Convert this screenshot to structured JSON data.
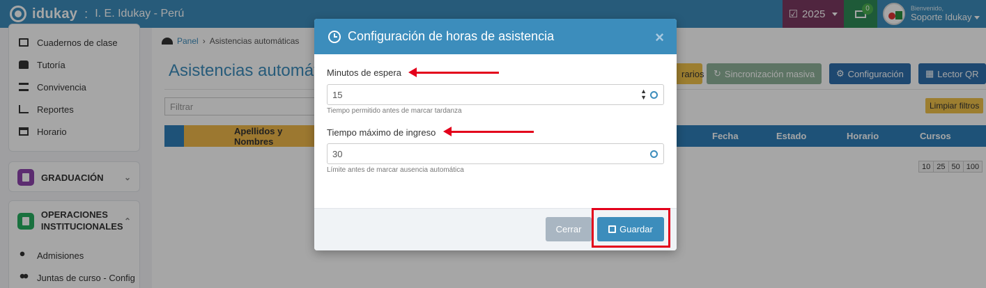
{
  "topbar": {
    "brand": "idukay",
    "separator": ":",
    "institution": "I. E. Idukay - Perú",
    "year": "2025",
    "messages_count": "0",
    "user_greeting": "Bienvenido,",
    "user_name": "Soporte Idukay"
  },
  "sidebar": {
    "top_items": [
      {
        "label": "Cuadernos de clase",
        "icon": "notebook-icon"
      },
      {
        "label": "Tutoría",
        "icon": "thumbs-up-icon"
      },
      {
        "label": "Convivencia",
        "icon": "list-icon"
      },
      {
        "label": "Reportes",
        "icon": "bar-chart-icon"
      },
      {
        "label": "Horario",
        "icon": "calendar-icon"
      }
    ],
    "sections": [
      {
        "label": "GRADUACIÓN",
        "color": "#8e44ad"
      },
      {
        "label": "OPERACIONES INSTITUCIONALES",
        "color": "#27ae60"
      }
    ],
    "bottom_items": [
      {
        "label": "Admisiones",
        "icon": "add-user-icon"
      },
      {
        "label": "Juntas de curso - Config",
        "icon": "users-icon"
      }
    ]
  },
  "breadcrumb": {
    "home": "Panel",
    "current": "Asistencias automáticas"
  },
  "page_title": "Asistencias automáticas",
  "toolbar": {
    "partial_label": "rarios",
    "sync_label": "Sincronización masiva",
    "config_label": "Configuración",
    "qr_label": "Lector QR"
  },
  "filter": {
    "placeholder": "Filtrar"
  },
  "clear_filters": "Limpiar filtros",
  "table": {
    "columns": [
      "Apellidos y Nombres",
      "Fecha",
      "Estado",
      "Horario",
      "Cursos"
    ]
  },
  "pager": [
    "10",
    "25",
    "50",
    "100"
  ],
  "modal": {
    "title": "Configuración de horas de asistencia",
    "close": "×",
    "wait_label": "Minutos de espera",
    "wait_value": "15",
    "wait_help": "Tiempo permitido antes de marcar tardanza",
    "max_label": "Tiempo máximo de ingreso",
    "max_value": "30",
    "max_help": "Límite antes de marcar ausencia automática",
    "cancel": "Cerrar",
    "save": "Guardar"
  },
  "colors": {
    "primary": "#3c8dbc",
    "highlight": "#e3001b",
    "warning": "#f0c24b",
    "sync": "#8fb39a"
  }
}
